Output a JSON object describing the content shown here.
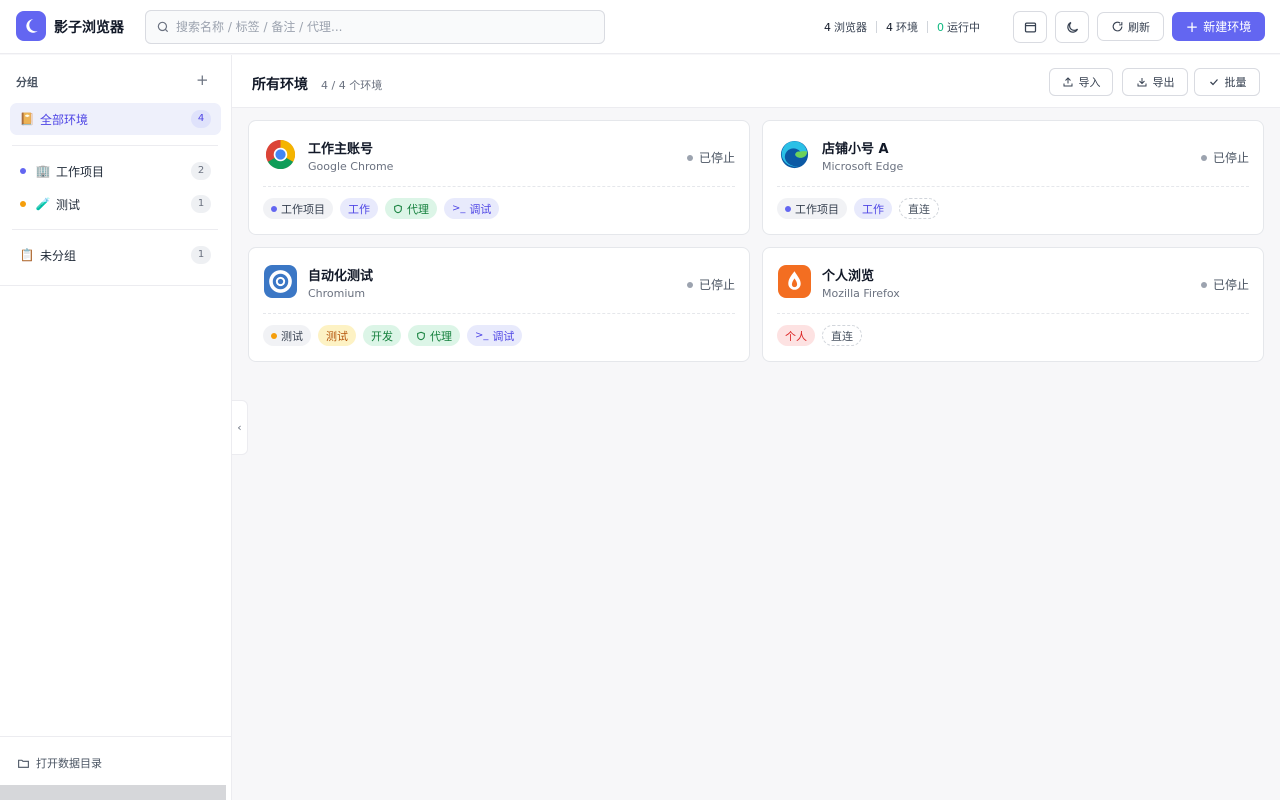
{
  "header": {
    "app_title": "影子浏览器",
    "search_placeholder": "搜索名称 / 标签 / 备注 / 代理...",
    "stats": [
      {
        "num": "4",
        "label": "浏览器"
      },
      {
        "num": "4",
        "label": "环境"
      },
      {
        "num": "0",
        "label": "运行中"
      }
    ],
    "refresh_label": "刷新",
    "new_label": "新建环境"
  },
  "sidebar": {
    "heading": "分组",
    "add_icon": "+",
    "items": [
      {
        "label": "全部环境",
        "count": "4",
        "icon": "📔"
      },
      {
        "label": "工作项目",
        "count": "2",
        "icon": "🏢",
        "dot": "#6366f1"
      },
      {
        "label": "测试",
        "count": "1",
        "icon": "🧪",
        "dot": "#f59e0b"
      },
      {
        "label": "未分组",
        "count": "1",
        "icon": "📋"
      }
    ],
    "footer_label": "打开数据目录"
  },
  "main": {
    "title": "所有环境",
    "subtitle": "4 / 4 个环境",
    "buttons": {
      "import": "导入",
      "export": "导出",
      "batch": "批量"
    },
    "cards": [
      {
        "name": "工作主账号",
        "browser": "Google Chrome",
        "status": "已停止",
        "icon": "chrome-icon",
        "tags": [
          {
            "text": "工作项目",
            "kind": "group",
            "dot": "#6366f1"
          },
          {
            "text": "工作",
            "kind": "blue"
          },
          {
            "text": "代理",
            "kind": "green",
            "glyph": "shield"
          },
          {
            "text": "调试",
            "kind": "purple",
            "glyph": "terminal"
          }
        ]
      },
      {
        "name": "店铺小号 A",
        "browser": "Microsoft Edge",
        "status": "已停止",
        "icon": "edge-icon",
        "tags": [
          {
            "text": "工作项目",
            "kind": "group",
            "dot": "#6366f1"
          },
          {
            "text": "工作",
            "kind": "blue"
          },
          {
            "text": "直连",
            "kind": "plain"
          }
        ]
      },
      {
        "name": "自动化测试",
        "browser": "Chromium",
        "status": "已停止",
        "icon": "chromium-icon",
        "tags": [
          {
            "text": "测试",
            "kind": "group",
            "dot": "#f59e0b"
          },
          {
            "text": "测试",
            "kind": "yellow"
          },
          {
            "text": "开发",
            "kind": "green"
          },
          {
            "text": "代理",
            "kind": "green",
            "glyph": "shield"
          },
          {
            "text": "调试",
            "kind": "purple",
            "glyph": "terminal"
          }
        ]
      },
      {
        "name": "个人浏览",
        "browser": "Mozilla Firefox",
        "status": "已停止",
        "icon": "firefox-icon",
        "tags": [
          {
            "text": "个人",
            "kind": "red"
          },
          {
            "text": "直连",
            "kind": "plain"
          }
        ]
      }
    ]
  },
  "colors": {
    "accent": "#6366f1",
    "running": "#10b981",
    "stopped": "#9ca3af"
  }
}
